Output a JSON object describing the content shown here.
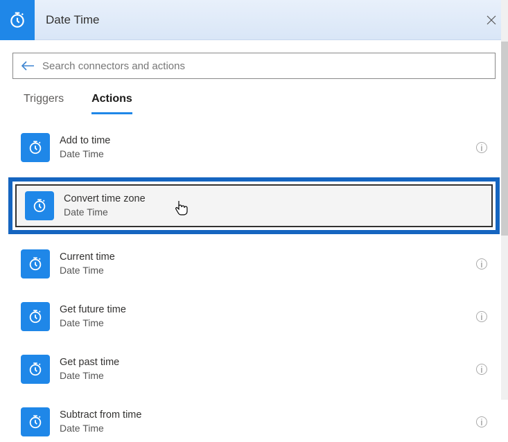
{
  "header": {
    "title": "Date Time"
  },
  "search": {
    "placeholder": "Search connectors and actions",
    "value": ""
  },
  "tabs": {
    "triggers": "Triggers",
    "actions": "Actions"
  },
  "actions": [
    {
      "title": "Add to time",
      "subtitle": "Date Time"
    },
    {
      "title": "Convert time zone",
      "subtitle": "Date Time"
    },
    {
      "title": "Current time",
      "subtitle": "Date Time"
    },
    {
      "title": "Get future time",
      "subtitle": "Date Time"
    },
    {
      "title": "Get past time",
      "subtitle": "Date Time"
    },
    {
      "title": "Subtract from time",
      "subtitle": "Date Time"
    }
  ]
}
